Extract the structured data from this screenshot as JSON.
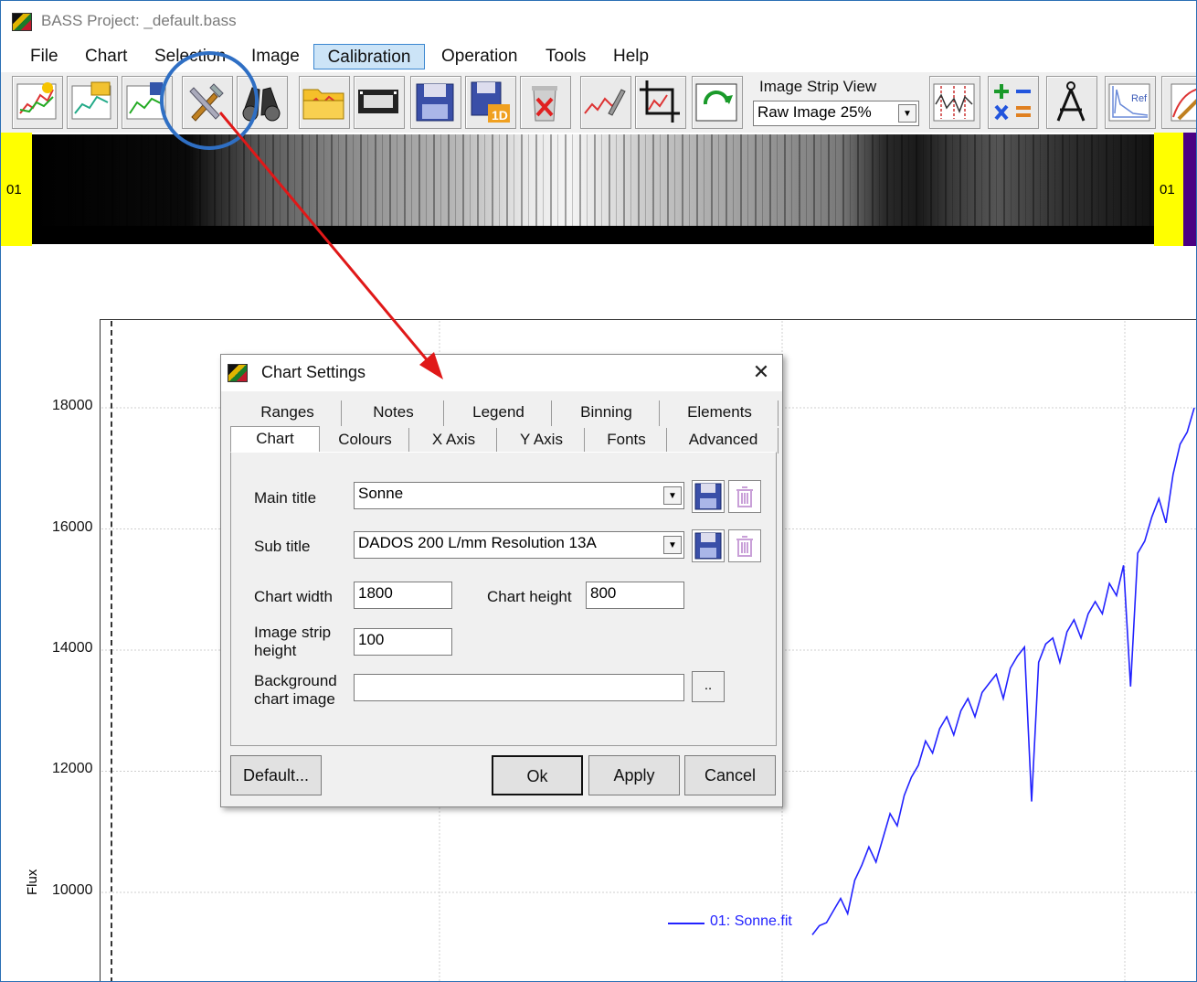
{
  "window": {
    "title": "BASS Project: _default.bass"
  },
  "menu": [
    "File",
    "Chart",
    "Selection",
    "Image",
    "Calibration",
    "Operation",
    "Tools",
    "Help"
  ],
  "menu_active": "Calibration",
  "toolbar": {
    "icons": [
      "new-chart-icon",
      "open-chart-icon",
      "save-chart-icon",
      "chart-settings-icon",
      "binoculars-icon",
      "open-folder-icon",
      "film-strip-icon",
      "save-disk-icon",
      "save-1d-icon",
      "delete-icon",
      "wrench-spectrum-icon",
      "crop-icon",
      "refresh-icon",
      "channels-icon",
      "math-operations-icon",
      "compass-icon",
      "reference-icon",
      "edit-chart-icon"
    ],
    "save_1d_label": "1D",
    "reference_label": "Ref",
    "image_strip_view_label": "Image Strip View",
    "image_strip_view_value": "Raw Image 25%"
  },
  "image_strip": {
    "left_label": "01",
    "right_label": "01"
  },
  "chart": {
    "y_ticks": [
      "18000",
      "16000",
      "14000",
      "12000",
      "10000"
    ],
    "y_axis_label": "Flux",
    "legend": "01: Sonne.fit",
    "line_color": "#2222ff"
  },
  "chart_data": {
    "type": "line",
    "ylabel": "Flux",
    "ylim": [
      9000,
      19000
    ],
    "y_ticks": [
      10000,
      12000,
      14000,
      16000,
      18000
    ],
    "series": [
      {
        "name": "01: Sonne.fit",
        "y": [
          9300,
          9450,
          9500,
          9700,
          9900,
          9650,
          10200,
          10450,
          10750,
          10500,
          10900,
          11300,
          11100,
          11600,
          11900,
          12100,
          12500,
          12300,
          12700,
          12900,
          12600,
          13000,
          13200,
          12900,
          13300,
          13450,
          13600,
          13200,
          13700,
          13900,
          14050,
          11500,
          13800,
          14100,
          14200,
          13800,
          14300,
          14500,
          14200,
          14600,
          14800,
          14600,
          15100,
          14900,
          15400,
          13400,
          15600,
          15800,
          16200,
          16500,
          16100,
          16900,
          17400,
          17600,
          18000
        ]
      }
    ]
  },
  "dialog": {
    "title": "Chart Settings",
    "close": "✕",
    "tabs_back": [
      "Ranges",
      "Notes",
      "Legend",
      "Binning",
      "Elements"
    ],
    "tabs_front": [
      "Chart",
      "Colours",
      "X Axis",
      "Y Axis",
      "Fonts",
      "Advanced"
    ],
    "selected_tab": "Chart",
    "main_title_label": "Main title",
    "main_title_value": "Sonne",
    "sub_title_label": "Sub title",
    "sub_title_value": "DADOS 200 L/mm Resolution 13A",
    "chart_width_label": "Chart width",
    "chart_width_value": "1800",
    "chart_height_label": "Chart height",
    "chart_height_value": "800",
    "image_strip_height_label_1": "Image strip",
    "image_strip_height_label_2": "height",
    "image_strip_height_value": "100",
    "background_label_1": "Background",
    "background_label_2": "chart image",
    "background_value": "",
    "browse_label": "..",
    "buttons": {
      "default": "Default...",
      "ok": "Ok",
      "apply": "Apply",
      "cancel": "Cancel"
    }
  },
  "annotation_colors": {
    "circle": "#2f6fc4",
    "arrow": "#e01818"
  }
}
